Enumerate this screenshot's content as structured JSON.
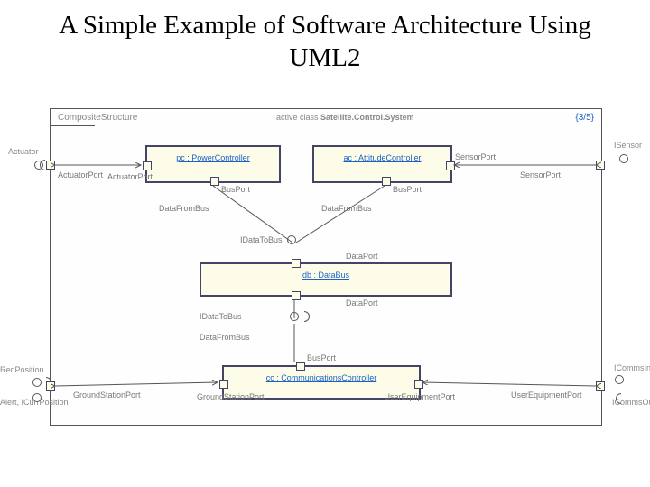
{
  "title": "A Simple Example of Software Architecture Using UML2",
  "diagram": {
    "header_left": "CompositeStructure",
    "header_mid_prefix": "active class",
    "header_mid_name": "Satellite.Control.System",
    "header_right": "{3/5}",
    "components": {
      "pc": "pc : PowerController",
      "ac": "ac : AttitudeController",
      "db": "db : DataBus",
      "cc": "cc : CommunicationsController"
    },
    "ports": {
      "actuator_port": "ActuatorPort",
      "sensor_port": "SensorPort",
      "bus_port": "BusPort",
      "data_port": "DataPort",
      "ground_station_port": "GroundStationPort",
      "user_equipment_port": "UserEquipmentPort"
    },
    "interfaces": {
      "data_from_bus": "DataFromBus",
      "data_to_bus": "IDataToBus",
      "idata_to_bus": "IDataToBus",
      "data_from_bus2": "DataFromBus"
    },
    "external": {
      "actuator": "Actuator",
      "isensor": "ISensor",
      "req_position": "ReqPosition",
      "alert_icurr": "Alert, ICurrPosition",
      "icomms_in": "ICommsIn",
      "icomms_out": "ICommsOut"
    }
  }
}
